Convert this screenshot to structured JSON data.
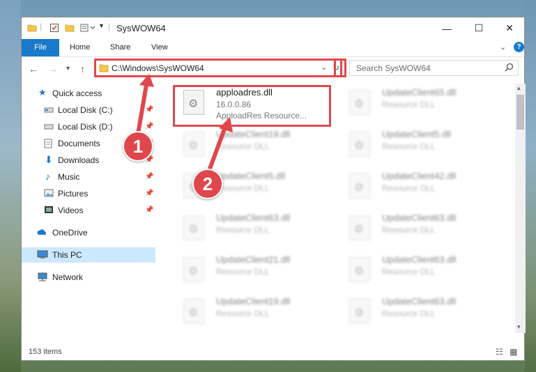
{
  "window": {
    "title": "SysWOW64"
  },
  "window_controls": {
    "minimize": "—",
    "maximize": "☐",
    "close": "✕"
  },
  "ribbon": {
    "tabs": [
      "File",
      "Home",
      "Share",
      "View"
    ]
  },
  "address": {
    "path": "C:\\Windows\\SysWOW64"
  },
  "search": {
    "placeholder": "Search SysWOW64"
  },
  "nav": {
    "items": [
      {
        "label": "Quick access",
        "icon": "star-icon",
        "pinned": false
      },
      {
        "label": "Local Disk (C:)",
        "icon": "drive-icon",
        "pinned": true
      },
      {
        "label": "Local Disk (D:)",
        "icon": "drive-icon",
        "pinned": true
      },
      {
        "label": "Documents",
        "icon": "documents-icon",
        "pinned": true
      },
      {
        "label": "Downloads",
        "icon": "downloads-icon",
        "pinned": true
      },
      {
        "label": "Music",
        "icon": "music-icon",
        "pinned": true
      },
      {
        "label": "Pictures",
        "icon": "pictures-icon",
        "pinned": true
      },
      {
        "label": "Videos",
        "icon": "videos-icon",
        "pinned": true
      },
      {
        "label": "OneDrive",
        "icon": "onedrive-icon",
        "pinned": false
      },
      {
        "label": "This PC",
        "icon": "pc-icon",
        "pinned": false,
        "selected": true
      },
      {
        "label": "Network",
        "icon": "network-icon",
        "pinned": false
      }
    ]
  },
  "files": [
    {
      "name": "apploadres.dll",
      "version": "16.0.0.86",
      "desc": "ApploadRes Resource...",
      "highlight": true
    },
    {
      "name": "UpdateClient65.dll",
      "desc": "Resource DLL"
    },
    {
      "name": "UpdateClient19.dll",
      "desc": "Resource DLL"
    },
    {
      "name": "UpdateClient5.dll",
      "desc": "Resource DLL"
    },
    {
      "name": "UpdateClient5.dll",
      "desc": "Resource DLL"
    },
    {
      "name": "UpdateClient42.dll",
      "desc": "Resource DLL"
    },
    {
      "name": "UpdateClient63.dll",
      "desc": "Resource DLL"
    },
    {
      "name": "UpdateClient63.dll",
      "desc": "Resource DLL"
    },
    {
      "name": "UpdateClient21.dll",
      "desc": "Resource DLL"
    },
    {
      "name": "UpdateClient63.dll",
      "desc": "Resource DLL"
    },
    {
      "name": "UpdateClient19.dll",
      "desc": "Resource DLL"
    },
    {
      "name": "UpdateClient63.dll",
      "desc": "Resource DLL"
    }
  ],
  "status": {
    "items": "153 items"
  },
  "callouts": [
    "1",
    "2"
  ],
  "colors": {
    "accent": "#1979ca",
    "highlight": "#e0474c",
    "selected": "#cce8ff"
  }
}
